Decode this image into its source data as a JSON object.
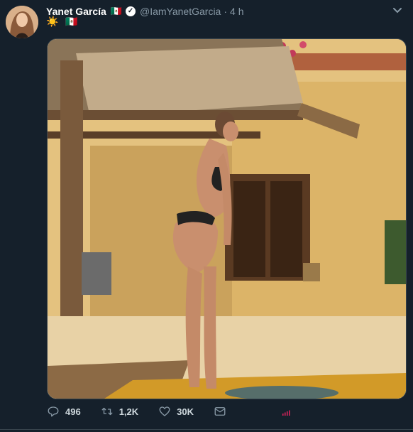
{
  "tweet": {
    "display_name": "Yanet García",
    "name_flag": "🇲🇽",
    "handle": "@IamYanetGarcia",
    "separator": "·",
    "time": "4 h",
    "text_emoji_1": "☀️",
    "text_emoji_2": "🇲🇽"
  },
  "actions": {
    "reply_count": "496",
    "retweet_count": "1,2K",
    "like_count": "30K"
  },
  "colors": {
    "background": "#15202b",
    "muted": "#8899a6",
    "analytics": "#e0245e"
  }
}
